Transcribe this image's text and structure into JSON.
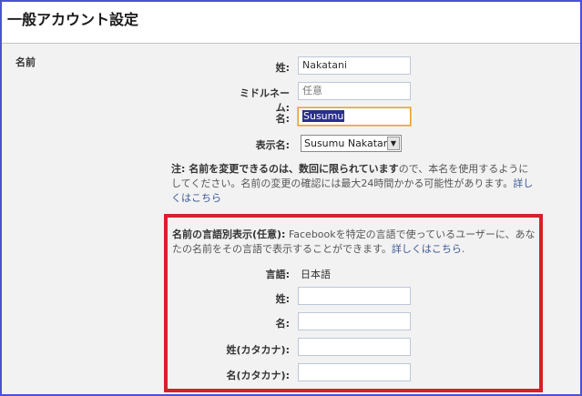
{
  "header": {
    "title": "一般アカウント設定"
  },
  "name_section": {
    "label": "名前",
    "last_name": {
      "label": "姓:",
      "value": "Nakatani"
    },
    "middle_name": {
      "label": "ミドルネーム:",
      "placeholder": "任意"
    },
    "first_name": {
      "label": "名:",
      "value": "Susumu"
    },
    "display_name": {
      "label": "表示名:",
      "value": "Susumu Nakatani"
    },
    "note": {
      "bold": "注: 名前を変更できるのは、数回に限られています",
      "text": "ので、本名を使用するようにしてください。名前の変更の確認には最大24時間かかる可能性があります。",
      "link": "詳しくはこちら"
    }
  },
  "alternate_name": {
    "title": "名前の言語別表示(任意):",
    "description": " Facebookを特定の言語で使っているユーザーに、あなたの名前をその言語で表示することができます。",
    "link": "詳しくはこちら",
    "link_suffix": ".",
    "language": {
      "label": "言語:",
      "value": "日本語"
    },
    "last_name": {
      "label": "姓:",
      "value": ""
    },
    "first_name": {
      "label": "名:",
      "value": ""
    },
    "last_name_kana": {
      "label": "姓(カタカナ):",
      "value": ""
    },
    "first_name_kana": {
      "label": "名(カタカナ):",
      "value": ""
    }
  },
  "colors": {
    "frame_border": "#4a52d4",
    "highlight_box": "#d6202a",
    "link": "#3b5998",
    "focus": "#e8a030",
    "selection": "#2a2f8a"
  },
  "icons": {
    "select_arrow": "chevron-down-icon"
  }
}
